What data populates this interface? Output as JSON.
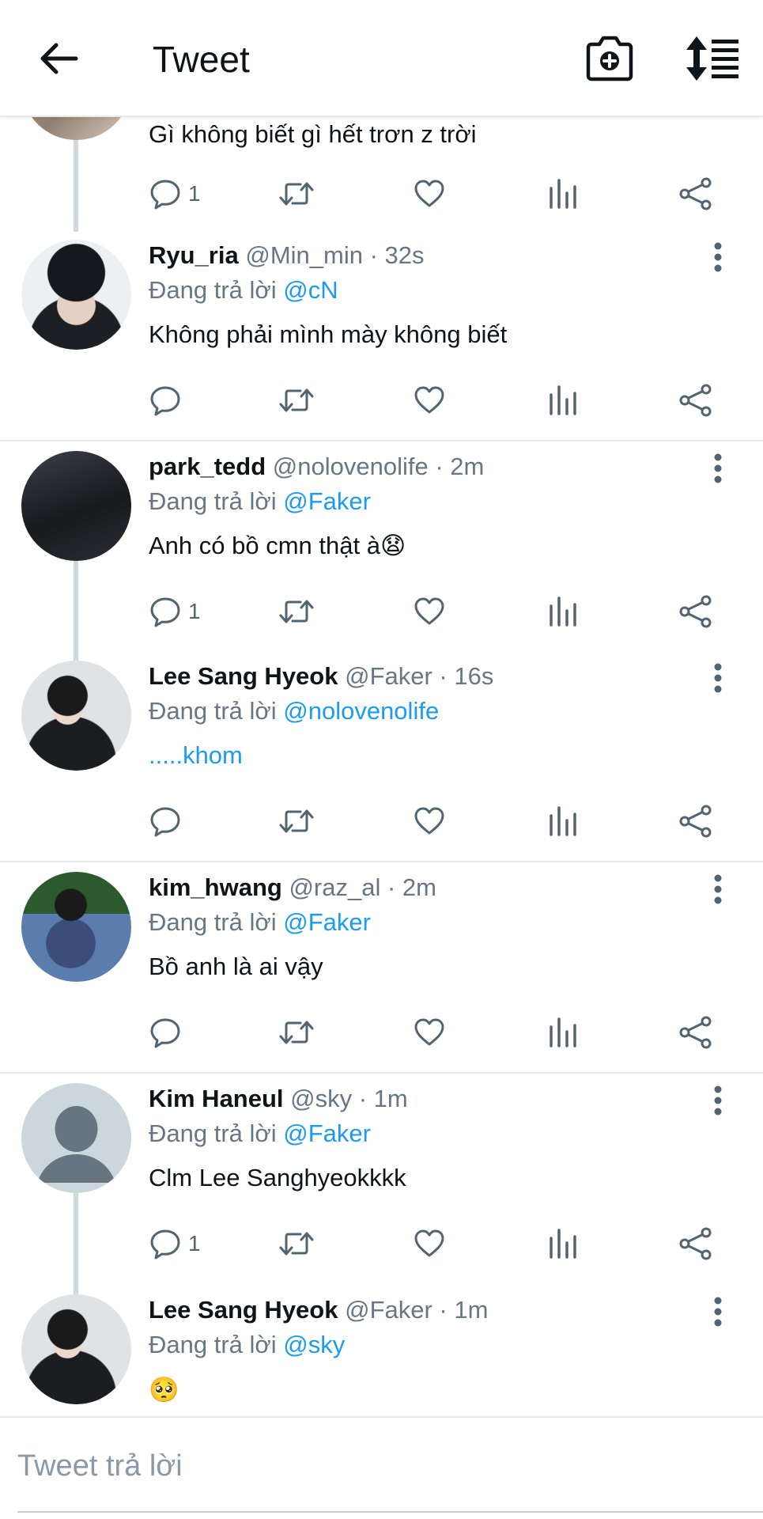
{
  "header": {
    "title": "Tweet"
  },
  "reply_placeholder": "Tweet trả lời",
  "top_partial": {
    "text": "Gì không biết gì hết trơn z trời",
    "reply_count": "1"
  },
  "tweets": [
    {
      "name": "Ryu_ria",
      "meta": "@Min_min · 32s",
      "replying_prefix": "Đang trả lời",
      "mention": "@cN",
      "text": "Không phải mình mày không biết",
      "reply_count": ""
    },
    {
      "name": "park_tedd",
      "meta": "@nolovenolife · 2m",
      "replying_prefix": "Đang trả lời",
      "mention": "@Faker",
      "text": "Anh có bồ cmn thật à😧",
      "reply_count": "1"
    },
    {
      "name": "Lee Sang Hyeok",
      "meta": "@Faker · 16s",
      "replying_prefix": "Đang trả lời",
      "mention": "@nolovenolife",
      "text": ".....khom",
      "reply_count": ""
    },
    {
      "name": "kim_hwang",
      "meta": "@raz_al · 2m",
      "replying_prefix": "Đang trả lời",
      "mention": "@Faker",
      "text": "Bồ anh là ai vậy",
      "reply_count": ""
    },
    {
      "name": "Kim Haneul",
      "meta": "@sky · 1m",
      "replying_prefix": "Đang trả lời",
      "mention": "@Faker",
      "text": "Clm Lee Sanghyeokkkk",
      "reply_count": "1"
    },
    {
      "name": "Lee Sang Hyeok",
      "meta": "@Faker · 1m",
      "replying_prefix": "Đang trả lời",
      "mention": "@sky",
      "text": "🥺",
      "reply_count": ""
    }
  ],
  "icons": {
    "back": "arrow-left-icon",
    "camera": "camera-plus-icon",
    "sort": "sort-icon",
    "reply": "reply-icon",
    "retweet": "retweet-icon",
    "like": "heart-icon",
    "stats": "stats-icon",
    "share": "share-icon",
    "more": "more-vertical-icon"
  },
  "colors": {
    "accent": "#1d9bf0",
    "muted": "#687684",
    "divider": "#e6e9ec"
  }
}
